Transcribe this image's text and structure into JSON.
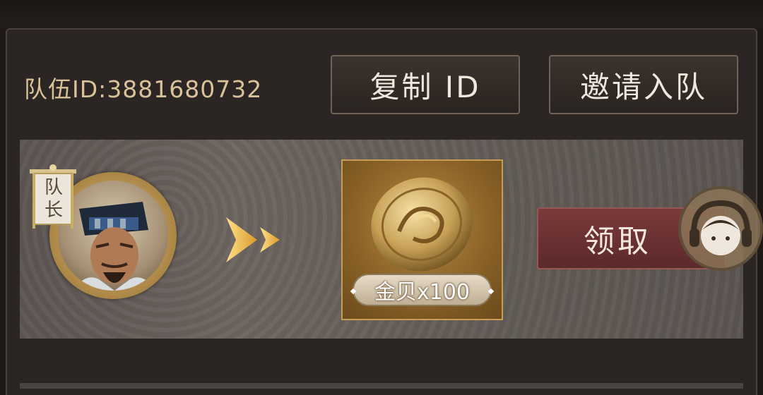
{
  "team": {
    "id_label": "队伍ID:",
    "id_value": "3881680732"
  },
  "buttons": {
    "copy_id": "复制 ID",
    "invite": "邀请入队",
    "claim": "领取"
  },
  "leader": {
    "badge_line1": "队",
    "badge_line2": "长"
  },
  "reward": {
    "item_label": "金贝x100"
  },
  "colors": {
    "gold_text": "#d9c29a",
    "claim_button": "#6a3233",
    "item_frame": "#c79d56"
  },
  "icons": [
    "flag-banner-icon",
    "double-arrow-icon",
    "gold-coin-icon",
    "customer-support-icon"
  ]
}
